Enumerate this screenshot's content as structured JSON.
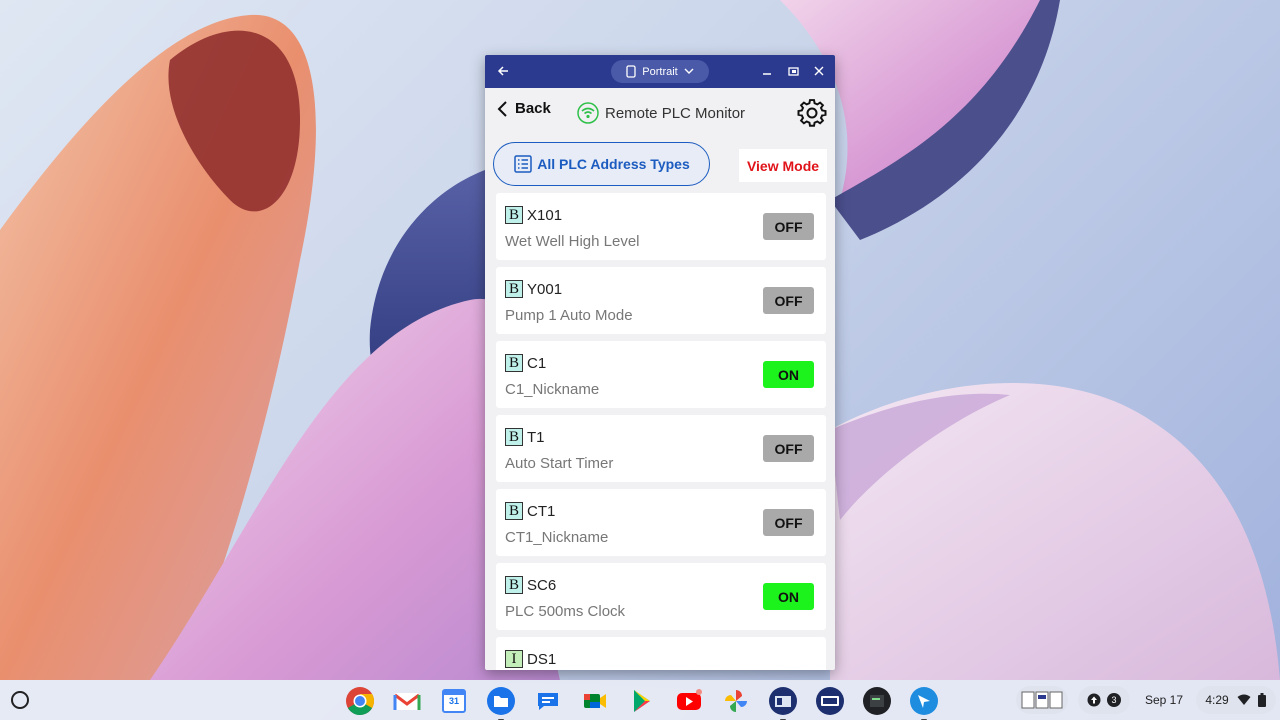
{
  "window": {
    "title_pill": "Portrait",
    "app_title": "Remote PLC Monitor",
    "back_label": "Back"
  },
  "toolbar": {
    "filter_label": "All PLC Address Types",
    "mode_label": "View Mode"
  },
  "items": [
    {
      "type": "B",
      "address": "X101",
      "nickname": "Wet Well High Level",
      "state": "OFF"
    },
    {
      "type": "B",
      "address": "Y001",
      "nickname": "Pump 1 Auto Mode",
      "state": "OFF"
    },
    {
      "type": "B",
      "address": "C1",
      "nickname": "C1_Nickname",
      "state": "ON"
    },
    {
      "type": "B",
      "address": "T1",
      "nickname": "Auto Start Timer",
      "state": "OFF"
    },
    {
      "type": "B",
      "address": "CT1",
      "nickname": "CT1_Nickname",
      "state": "OFF"
    },
    {
      "type": "B",
      "address": "SC6",
      "nickname": "PLC 500ms Clock",
      "state": "ON"
    },
    {
      "type": "I",
      "address": "DS1",
      "nickname": "",
      "state": ""
    }
  ],
  "shelf": {
    "apps": [
      "chrome-icon",
      "gmail-icon",
      "calendar-icon",
      "files-icon",
      "messages-icon",
      "meet-icon",
      "play-store-icon",
      "youtube-icon",
      "photos-icon",
      "click-plc-icon",
      "click-plus-icon",
      "terminal-icon",
      "plc-monitor-icon"
    ],
    "calendar_day": "31",
    "notification_count": "3",
    "date": "Sep 17",
    "time": "4:29"
  },
  "colors": {
    "titlebar": "#2b3a8f",
    "accent_blue": "#1c5cc0",
    "view_mode_red": "#e0131a",
    "on_green": "#1cf21c",
    "off_gray": "#a9a9a9"
  }
}
